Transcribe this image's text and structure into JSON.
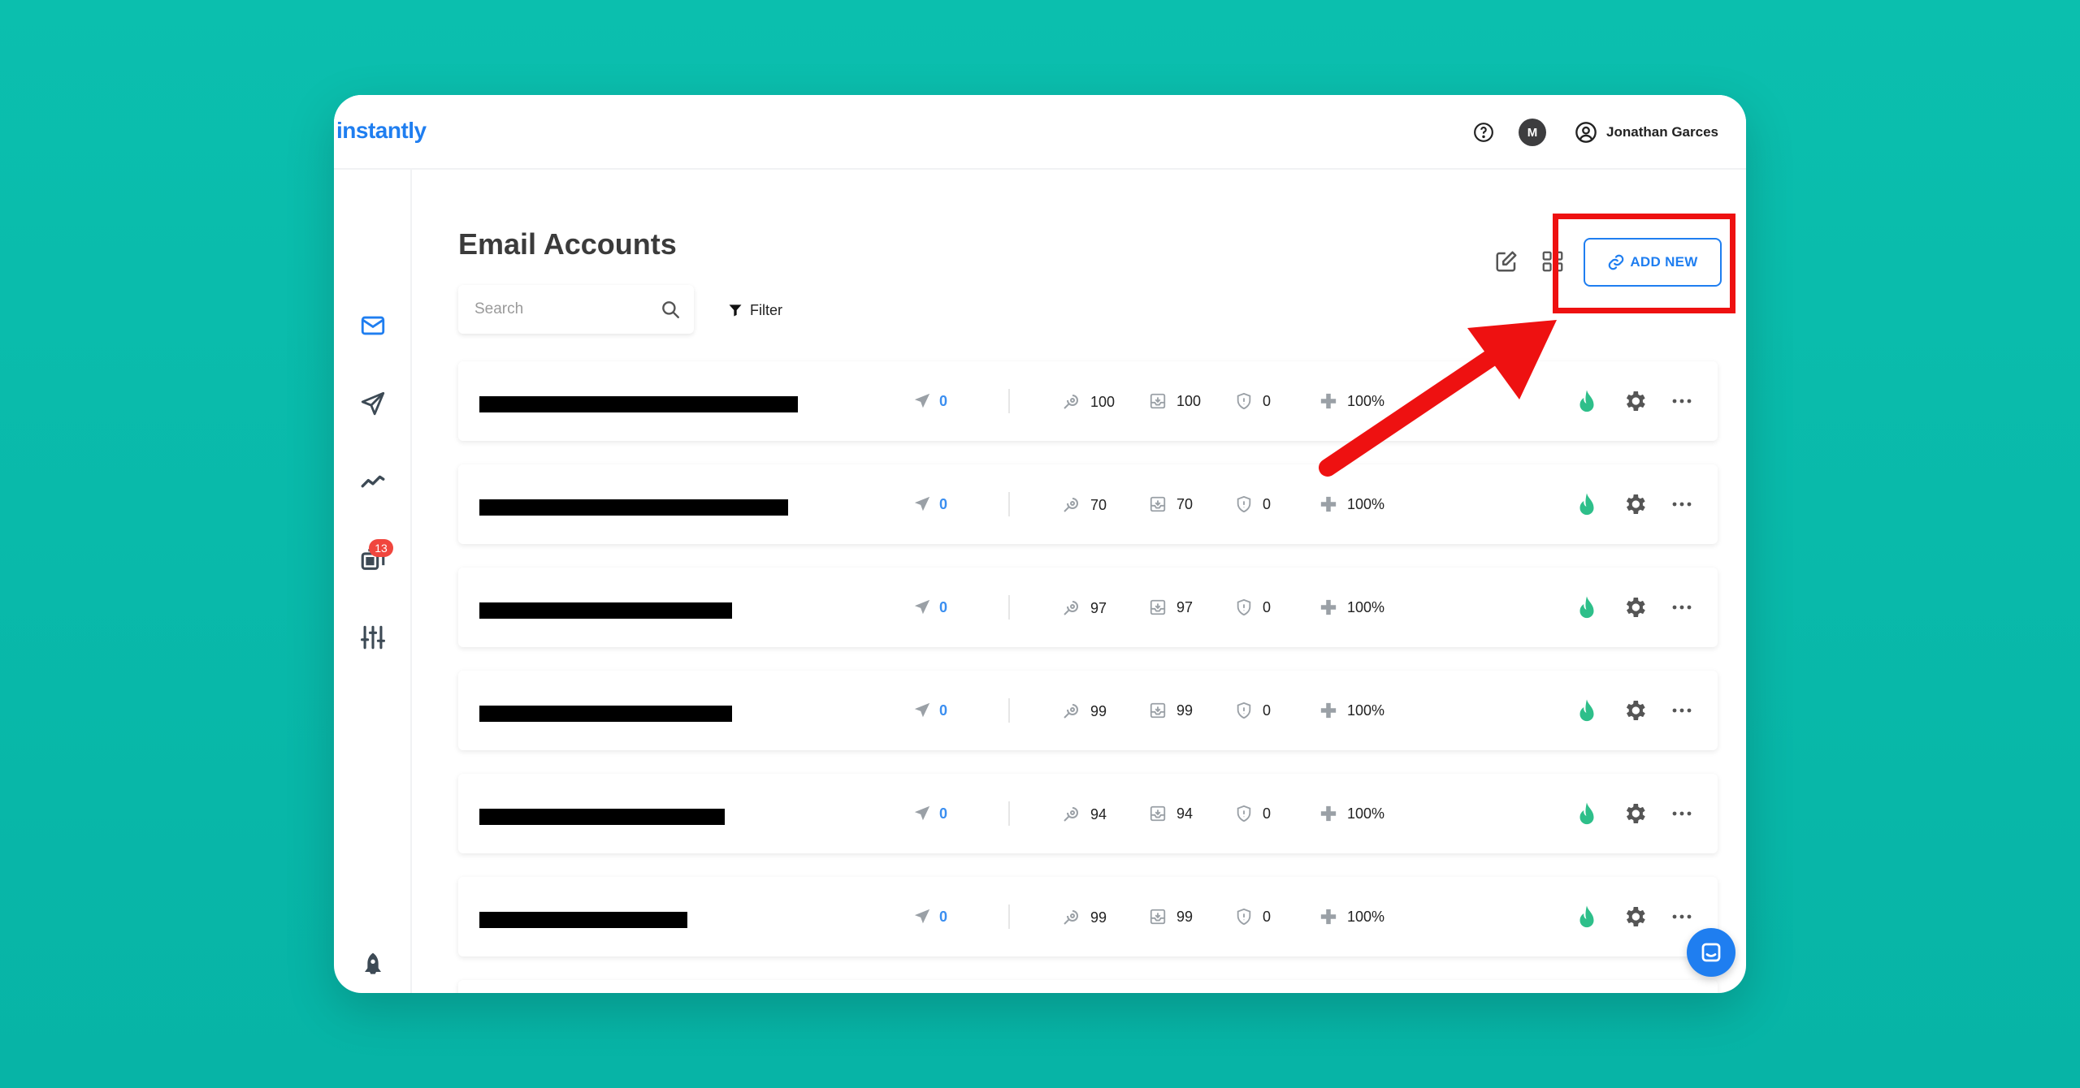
{
  "app": {
    "logo": "instantly",
    "accent": "#1f7ef0"
  },
  "topbar": {
    "help_icon": "question-circle-icon",
    "workspace_initial": "M",
    "user_name": "Jonathan Garces"
  },
  "sidebar": {
    "items": [
      {
        "icon": "mail-icon",
        "active": true
      },
      {
        "icon": "send-icon"
      },
      {
        "icon": "analytics-icon"
      },
      {
        "icon": "unibox-icon",
        "badge": "13"
      },
      {
        "icon": "settings-sliders-icon"
      },
      {
        "icon": "rocket-icon"
      }
    ]
  },
  "page": {
    "title": "Email Accounts",
    "search_placeholder": "Search",
    "filter_label": "Filter",
    "add_new_label": "ADD NEW"
  },
  "accounts": [
    {
      "sent": "0",
      "warmup": "100",
      "inbox": "100",
      "spam": "0",
      "health": "100%"
    },
    {
      "sent": "0",
      "warmup": "70",
      "inbox": "70",
      "spam": "0",
      "health": "100%"
    },
    {
      "sent": "0",
      "warmup": "97",
      "inbox": "97",
      "spam": "0",
      "health": "100%"
    },
    {
      "sent": "0",
      "warmup": "99",
      "inbox": "99",
      "spam": "0",
      "health": "100%"
    },
    {
      "sent": "0",
      "warmup": "94",
      "inbox": "94",
      "spam": "0",
      "health": "100%"
    },
    {
      "sent": "0",
      "warmup": "99",
      "inbox": "99",
      "spam": "0",
      "health": "100%"
    }
  ],
  "colors": {
    "background": "#0bbfae",
    "highlight": "#ee1111",
    "flame": "#2ebf8a",
    "badge": "#f0463e"
  }
}
